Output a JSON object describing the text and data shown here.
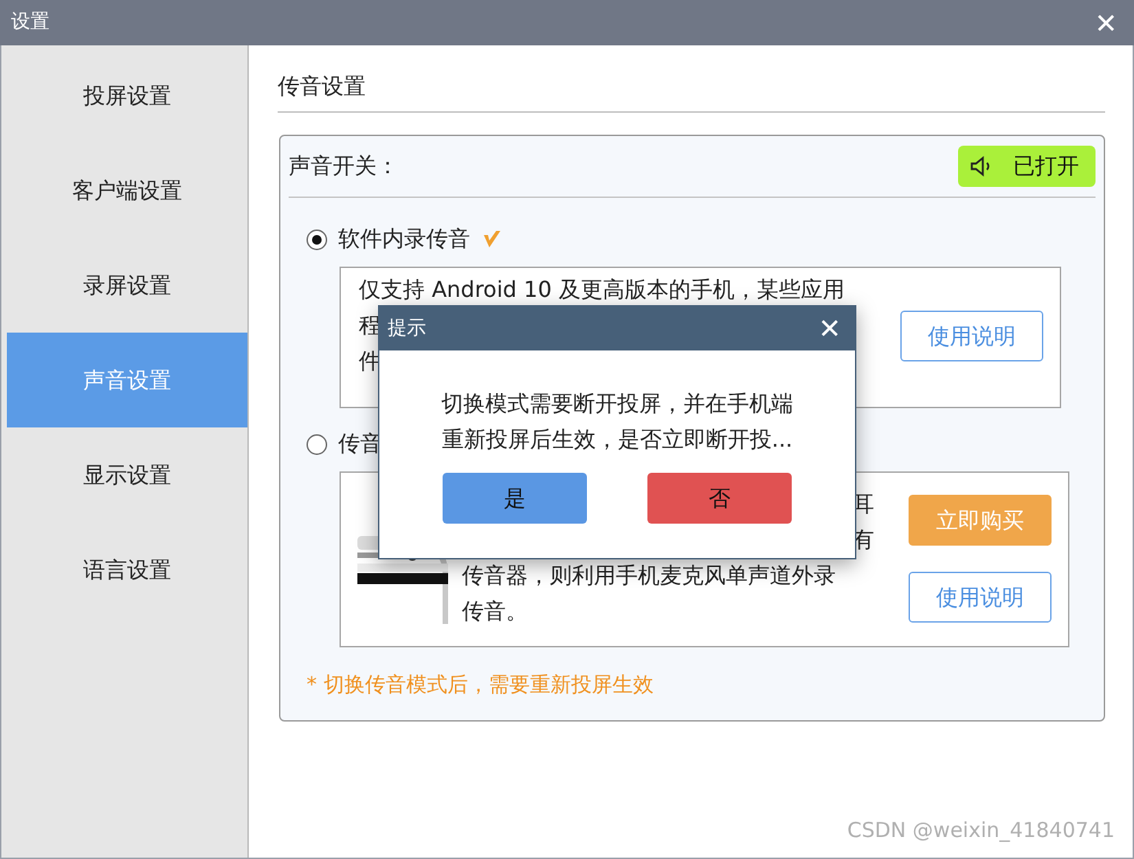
{
  "window": {
    "title": "设置",
    "close": "✕"
  },
  "sidebar": {
    "items": [
      {
        "label": "投屏设置",
        "selected": false
      },
      {
        "label": "客户端设置",
        "selected": false
      },
      {
        "label": "录屏设置",
        "selected": false
      },
      {
        "label": "声音设置",
        "selected": true
      },
      {
        "label": "显示设置",
        "selected": false
      },
      {
        "label": "语言设置",
        "selected": false
      }
    ]
  },
  "section_title": "传音设置",
  "sound_switch": {
    "label": "声音开关：",
    "state_text": "已打开",
    "on": true
  },
  "options": [
    {
      "label": "软件内录传音",
      "selected": true,
      "badge": true,
      "description_lines": [
        "仅支持 Android 10 及更高版本的手机，某些应用",
        "程",
        "件"
      ],
      "buttons": [
        {
          "label": "使用说明",
          "kind": "outline"
        }
      ]
    },
    {
      "label": "传音",
      "selected": false,
      "badge": false,
      "picture": true,
      "description_lines": [
        "耳",
        "有",
        "传音器，则利用手机麦克风单声道外录",
        "传音。"
      ],
      "buttons": [
        {
          "label": "立即购买",
          "kind": "primary"
        },
        {
          "label": "使用说明",
          "kind": "outline"
        }
      ]
    }
  ],
  "note": "* 切换传音模式后，需要重新投屏生效",
  "dialog": {
    "title": "提示",
    "close": "✕",
    "message_lines": [
      "切换模式需要断开投屏，并在手机端",
      "重新投屏后生效，是否立即断开投..."
    ],
    "buttons": [
      {
        "label": "是",
        "kind": "confirm"
      },
      {
        "label": "否",
        "kind": "cancel"
      }
    ]
  },
  "watermark": "CSDN @weixin_41840741"
}
